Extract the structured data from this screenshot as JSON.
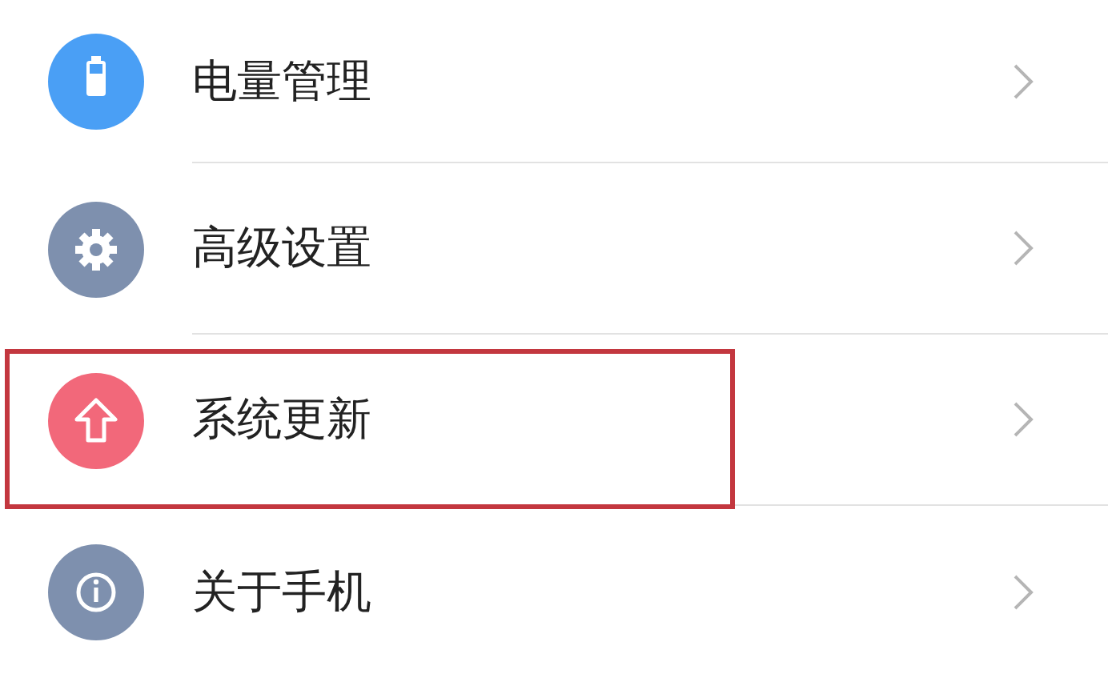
{
  "settings_items": [
    {
      "label": "电量管理",
      "kind": "battery",
      "color": "#4a9ff5",
      "highlighted": false
    },
    {
      "label": "高级设置",
      "kind": "gear",
      "color": "#7e90ae",
      "highlighted": false
    },
    {
      "label": "系统更新",
      "kind": "update",
      "color": "#f2687a",
      "highlighted": true
    },
    {
      "label": "关于手机",
      "kind": "info",
      "color": "#7e90ae",
      "highlighted": false
    }
  ]
}
